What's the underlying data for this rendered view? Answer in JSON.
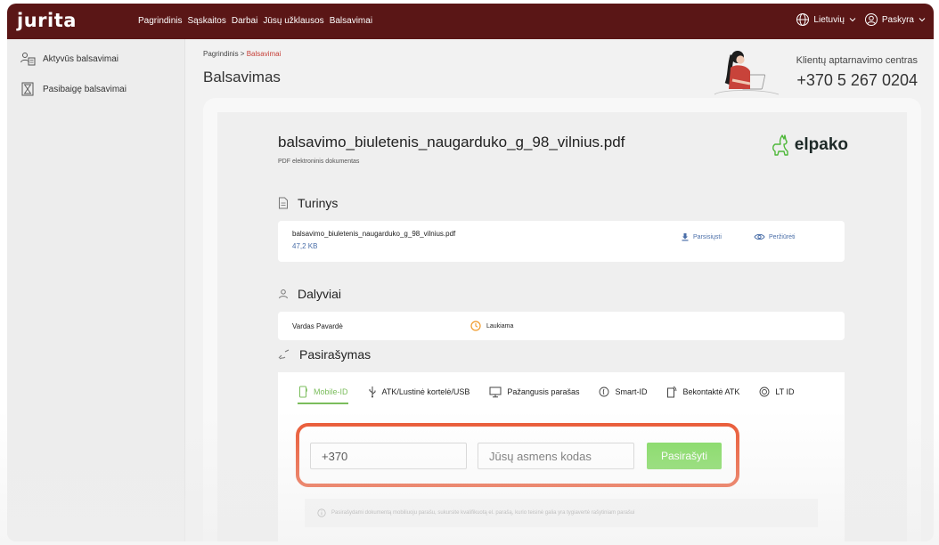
{
  "app": {
    "logo": "jurita"
  },
  "topnav": [
    {
      "label": "Pagrindinis"
    },
    {
      "label": "Sąskaitos"
    },
    {
      "label": "Darbai"
    },
    {
      "label": "Jūsų užklausos"
    },
    {
      "label": "Balsavimai"
    }
  ],
  "top_right": {
    "language": "Lietuvių",
    "account": "Paskyra"
  },
  "sidebar": {
    "items": [
      {
        "label": "Aktyvūs balsavimai",
        "icon": "users-group-icon"
      },
      {
        "label": "Pasibaigę balsavimai",
        "icon": "hourglass-icon"
      }
    ]
  },
  "breadcrumb": {
    "root": "Pagrindinis",
    "separator": " > ",
    "current": "Balsavimai"
  },
  "page_title": "Balsavimas",
  "contact": {
    "label": "Klientų aptarnavimo centras",
    "phone": "+370 5 267 0204"
  },
  "document": {
    "title": "balsavimo_biuletenis_naugarduko_g_98_vilnius.pdf",
    "subtitle": "PDF elektroninis dokumentas",
    "brand": "elpako"
  },
  "content_section": {
    "title": "Turinys",
    "file": {
      "name": "balsavimo_biuletenis_naugarduko_g_98_vilnius.pdf",
      "size": "47,2 KB",
      "download": "Parsisiųsti",
      "preview": "Peržiūrėti"
    }
  },
  "participants_section": {
    "title": "Dalyviai",
    "rows": [
      {
        "name": "Vardas Pavardė",
        "status": "Laukiama"
      }
    ]
  },
  "signing_section": {
    "title": "Pasirašymas",
    "tabs": [
      {
        "label": "Mobile-ID",
        "icon": "phone-icon",
        "active": true
      },
      {
        "label": "ATK/Lustinė kortelė/USB",
        "icon": "usb-icon",
        "active": false
      },
      {
        "label": "Pažangusis parašas",
        "icon": "monitor-icon",
        "active": false
      },
      {
        "label": "Smart-ID",
        "icon": "fingerprint-icon",
        "active": false
      },
      {
        "label": "Bekontaktė ATK",
        "icon": "contactless-card-icon",
        "active": false
      },
      {
        "label": "LT ID",
        "icon": "id-circle-icon",
        "active": false
      }
    ],
    "phone_value": "+370",
    "personal_code_placeholder": "Jūsų asmens kodas",
    "submit_label": "Pasirašyti",
    "note": "Pasirašydami dokumentą mobiliuoju parašu, sukursite kvalifikuotą el. parašą, kurio teisinė galia yra tygiavertė rašytiniam parašui"
  },
  "colors": {
    "topbar": "#5a1616",
    "accent_green": "#7ed95b",
    "highlight": "#ea5530",
    "link_blue": "#4a6ea8",
    "breadcrumb_active": "#c6413a"
  }
}
